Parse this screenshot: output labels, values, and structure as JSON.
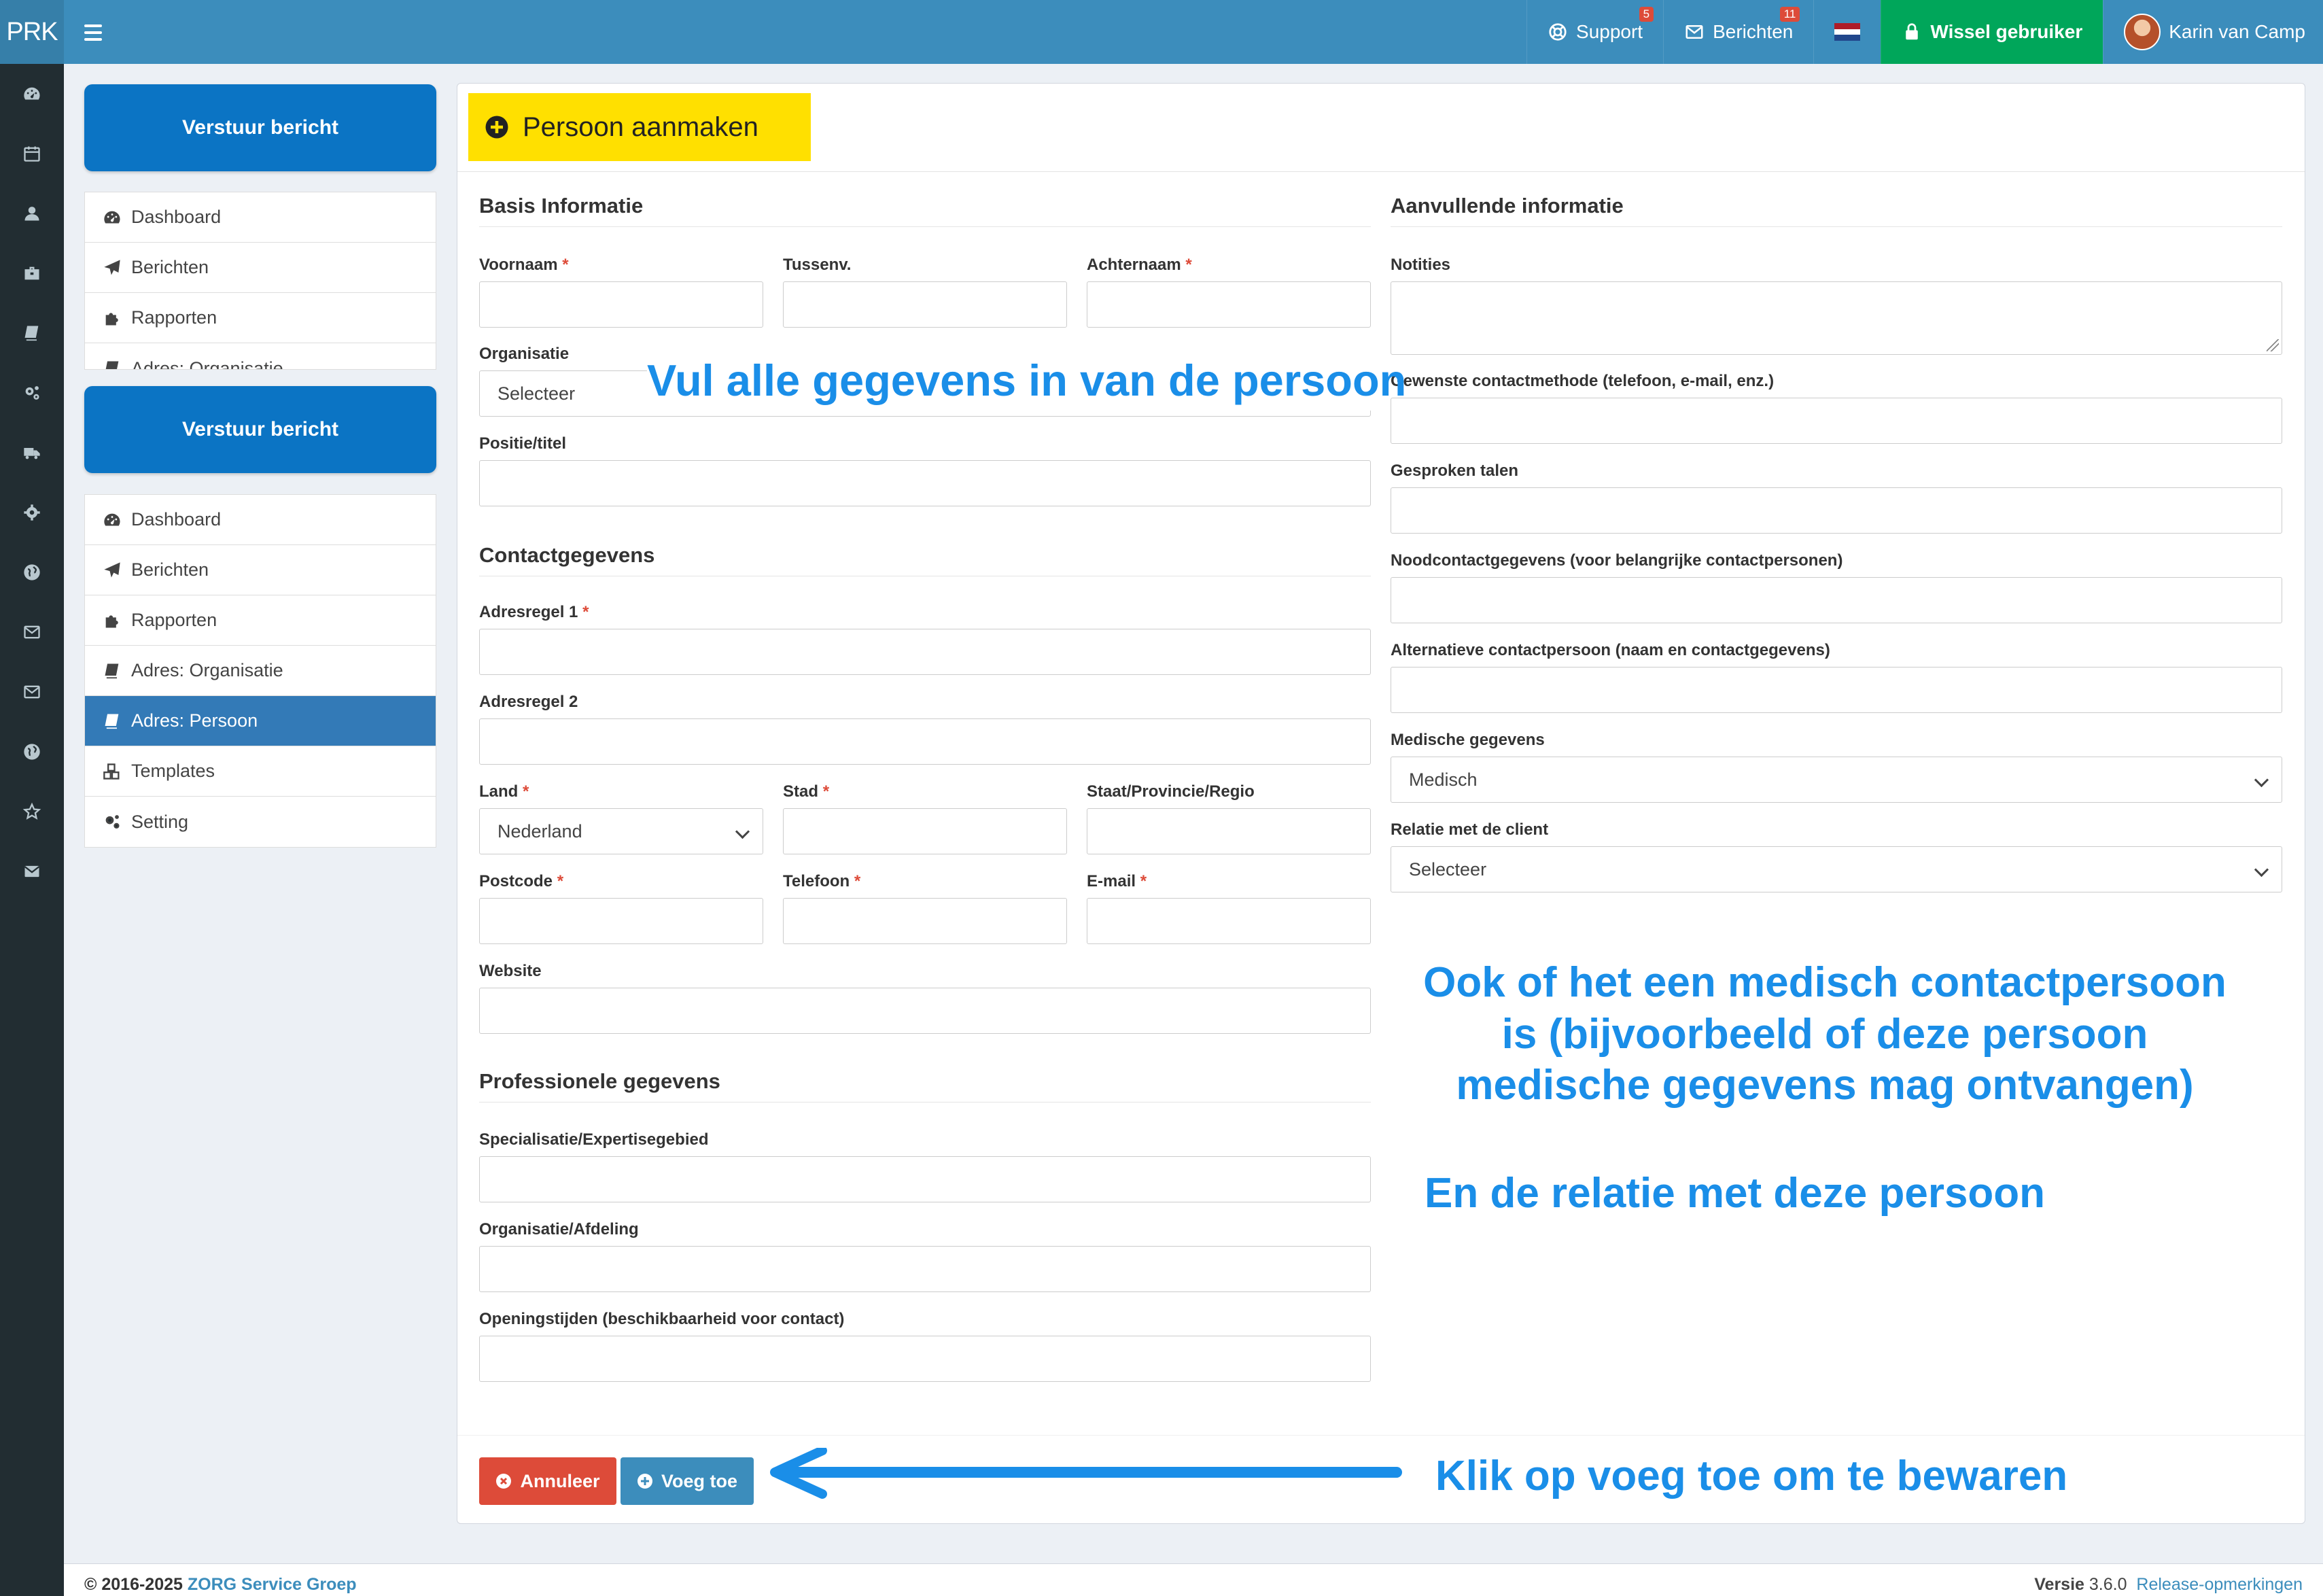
{
  "app": {
    "logo": "PRK"
  },
  "header": {
    "support_label": "Support",
    "support_badge": "5",
    "berichten_label": "Berichten",
    "berichten_badge": "11",
    "wissel_label": "Wissel gebruiker",
    "user_name": "Karin van Camp"
  },
  "rail_icons": [
    "dashboard-icon",
    "calendar-icon",
    "user-icon",
    "briefcase-icon",
    "book-icon",
    "cogs-icon",
    "truck-icon",
    "gear-icon",
    "globe-icon",
    "envelope-icon",
    "envelope-icon",
    "globe-icon",
    "star-icon",
    "envelope-solid-icon"
  ],
  "sidebar": {
    "send_button": "Verstuur bericht",
    "menu_top": [
      {
        "label": "Dashboard",
        "icon": "dashboard-icon"
      },
      {
        "label": "Berichten",
        "icon": "paper-plane-icon"
      },
      {
        "label": "Rapporten",
        "icon": "puzzle-icon"
      },
      {
        "label": "Adres: Organisatie",
        "icon": "book-icon"
      }
    ],
    "menu": [
      {
        "label": "Dashboard",
        "icon": "dashboard-icon"
      },
      {
        "label": "Berichten",
        "icon": "paper-plane-icon"
      },
      {
        "label": "Rapporten",
        "icon": "puzzle-icon"
      },
      {
        "label": "Adres: Organisatie",
        "icon": "book-icon"
      },
      {
        "label": "Adres: Persoon",
        "icon": "book-icon",
        "active": true
      },
      {
        "label": "Templates",
        "icon": "cubes-icon"
      },
      {
        "label": "Setting",
        "icon": "cogs-icon"
      }
    ]
  },
  "form": {
    "title": "Persoon aanmaken",
    "basis": {
      "title": "Basis Informatie",
      "voornaam": "Voornaam",
      "tussenv": "Tussenv.",
      "achternaam": "Achternaam",
      "organisatie": "Organisatie",
      "organisatie_value": "Selecteer",
      "positie": "Positie/titel"
    },
    "contact": {
      "title": "Contactgegevens",
      "adres1": "Adresregel 1",
      "adres2": "Adresregel 2",
      "land": "Land",
      "land_value": "Nederland",
      "stad": "Stad",
      "staat": "Staat/Provincie/Regio",
      "postcode": "Postcode",
      "telefoon": "Telefoon",
      "email": "E-mail",
      "website": "Website"
    },
    "professioneel": {
      "title": "Professionele gegevens",
      "specialisatie": "Specialisatie/Expertisegebied",
      "afdeling": "Organisatie/Afdeling",
      "openingstijden": "Openingstijden (beschikbaarheid voor contact)"
    },
    "aanvullend": {
      "title": "Aanvullende informatie",
      "notities": "Notities",
      "contactmethode": "Gewenste contactmethode (telefoon, e-mail, enz.)",
      "talen": "Gesproken talen",
      "nood": "Noodcontactgegevens (voor belangrijke contactpersonen)",
      "alternatief": "Alternatieve contactpersoon (naam en contactgegevens)",
      "medisch": "Medische gegevens",
      "medisch_value": "Medisch",
      "relatie": "Relatie met de client",
      "relatie_value": "Selecteer"
    },
    "required_mark": "*",
    "cancel_label": "Annuleer",
    "add_label": "Voeg toe"
  },
  "annotations": {
    "fill_in": "Vul alle gegevens in van de persoon",
    "medical_line1": "Ook of het een medisch contactpersoon",
    "medical_line2": "is (bijvoorbeeld of deze persoon",
    "medical_line3": "medische gegevens mag ontvangen)",
    "relation": "En de relatie met deze persoon",
    "save": "Klik op voeg toe om te bewaren"
  },
  "footer": {
    "copyright": "© 2016-2025",
    "company": "ZORG Service Groep",
    "version_label": "Versie",
    "version": "3.6.0",
    "release_notes": "Release-opmerkingen"
  },
  "colors": {
    "header": "#3c8dbc",
    "rail": "#222d32",
    "send_button": "#0b74c4",
    "wissel": "#00a65a",
    "active_menu": "#337ab7",
    "highlight": "#ffe000",
    "annotation": "#1a8ee8",
    "cancel": "#dd4b39"
  }
}
